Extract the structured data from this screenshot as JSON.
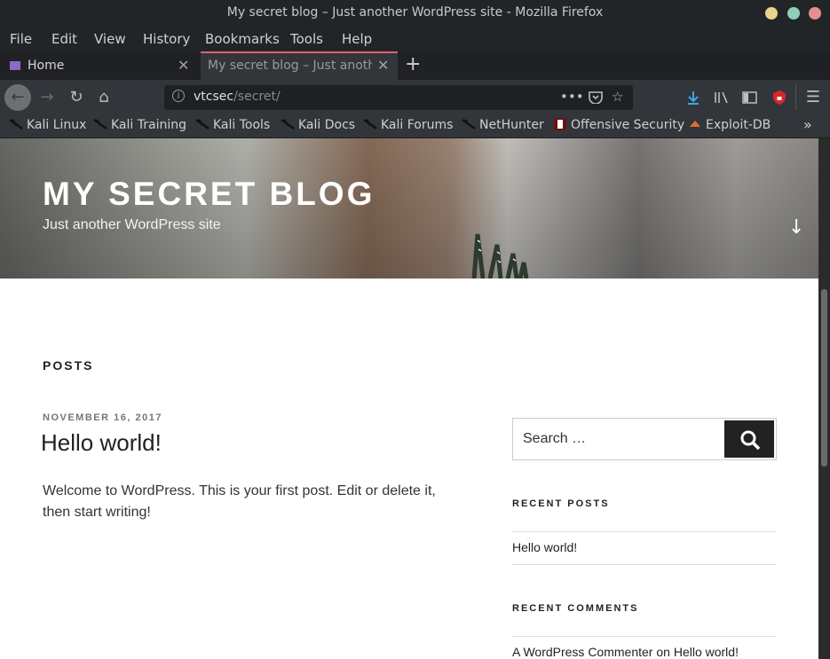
{
  "window": {
    "title": "My secret blog – Just another WordPress site - Mozilla Firefox"
  },
  "menu": {
    "file": "File",
    "edit": "Edit",
    "view": "View",
    "history": "History",
    "bookmarks": "Bookmarks",
    "tools": "Tools",
    "help": "Help"
  },
  "tabs": [
    {
      "label": "Home"
    },
    {
      "label": "My secret blog – Just anothe"
    }
  ],
  "url": {
    "host": "vtcsec",
    "path": "/secret/"
  },
  "bookmarks": [
    "Kali Linux",
    "Kali Training",
    "Kali Tools",
    "Kali Docs",
    "Kali Forums",
    "NetHunter",
    "Offensive Security",
    "Exploit-DB"
  ],
  "site": {
    "title": "MY SECRET BLOG",
    "tagline": "Just another WordPress site"
  },
  "main": {
    "heading": "POSTS",
    "post": {
      "date": "NOVEMBER 16, 2017",
      "title": "Hello world!",
      "excerpt": "Welcome to WordPress. This is your first post. Edit or delete it, then start writing!"
    }
  },
  "sidebar": {
    "search_placeholder": "Search …",
    "recent_posts_heading": "RECENT POSTS",
    "recent_posts": [
      "Hello world!"
    ],
    "recent_comments_heading": "RECENT COMMENTS",
    "comment": {
      "author": "A WordPress Commenter",
      "on": "on",
      "post": "Hello world!"
    }
  },
  "colors": {
    "accent_tab": "#e06070",
    "download": "#3ea6e0"
  }
}
